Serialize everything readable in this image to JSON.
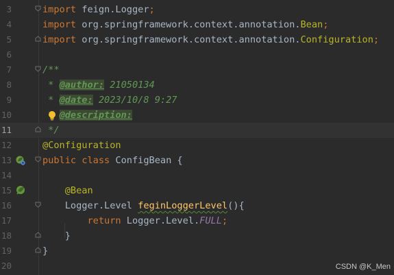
{
  "editor": {
    "lines": [
      {
        "num": "3",
        "parts": [
          {
            "t": "import ",
            "c": "kw"
          },
          {
            "t": "feign.Logger",
            "c": "plain"
          },
          {
            "t": ";",
            "c": "kw"
          }
        ]
      },
      {
        "num": "4",
        "parts": [
          {
            "t": "import ",
            "c": "kw"
          },
          {
            "t": "org.springframework.context.annotation.",
            "c": "plain"
          },
          {
            "t": "Bean",
            "c": "cls"
          },
          {
            "t": ";",
            "c": "kw"
          }
        ]
      },
      {
        "num": "5",
        "parts": [
          {
            "t": "import ",
            "c": "kw"
          },
          {
            "t": "org.springframework.context.annotation.",
            "c": "plain"
          },
          {
            "t": "Configuration",
            "c": "cls"
          },
          {
            "t": ";",
            "c": "kw"
          }
        ]
      },
      {
        "num": "6",
        "parts": []
      },
      {
        "num": "7",
        "parts": [
          {
            "t": "/**",
            "c": "doc"
          }
        ]
      },
      {
        "num": "8",
        "parts": [
          {
            "t": " * ",
            "c": "doc"
          },
          {
            "t": "@author:",
            "c": "doctag"
          },
          {
            "t": " 21050134",
            "c": "doc"
          }
        ]
      },
      {
        "num": "9",
        "parts": [
          {
            "t": " * ",
            "c": "doc"
          },
          {
            "t": "@date:",
            "c": "doctag"
          },
          {
            "t": " 2023/10/8 9:27",
            "c": "doc"
          }
        ]
      },
      {
        "num": "10",
        "parts": [
          {
            "t": " * ",
            "c": "doc"
          },
          {
            "t": "@description:",
            "c": "doctag"
          }
        ]
      },
      {
        "num": "11",
        "parts": [
          {
            "t": " */",
            "c": "doc"
          }
        ]
      },
      {
        "num": "12",
        "parts": [
          {
            "t": "@Configuration",
            "c": "ann"
          }
        ]
      },
      {
        "num": "13",
        "parts": [
          {
            "t": "public class ",
            "c": "kw"
          },
          {
            "t": "ConfigBean {",
            "c": "plain"
          }
        ]
      },
      {
        "num": "14",
        "parts": []
      },
      {
        "num": "15",
        "parts": [
          {
            "t": "    @Bean",
            "c": "ann"
          }
        ]
      },
      {
        "num": "16",
        "parts": [
          {
            "t": "    Logger.Level ",
            "c": "plain"
          },
          {
            "t": "feginLoggerLevel",
            "c": "fn"
          },
          {
            "t": "(){",
            "c": "plain"
          }
        ]
      },
      {
        "num": "17",
        "parts": [
          {
            "t": "        return ",
            "c": "kw"
          },
          {
            "t": "Logger.Level.",
            "c": "plain"
          },
          {
            "t": "FULL",
            "c": "const"
          },
          {
            "t": ";",
            "c": "kw"
          }
        ]
      },
      {
        "num": "18",
        "parts": [
          {
            "t": "    }",
            "c": "plain"
          }
        ]
      },
      {
        "num": "19",
        "parts": [
          {
            "t": "}",
            "c": "plain"
          }
        ]
      },
      {
        "num": "20",
        "parts": []
      }
    ],
    "current_line": "11"
  },
  "watermark": "CSDN @K_Men",
  "colors": {
    "background": "#2b2b2b",
    "keyword": "#cc7832",
    "annotation": "#bbb529",
    "doc_comment": "#629755",
    "method": "#ffc66d",
    "constant": "#9876aa"
  },
  "icons": {
    "line13": "spring-bean-config-icon",
    "line15": "spring-bean-icon",
    "line10": "lightbulb-icon"
  }
}
